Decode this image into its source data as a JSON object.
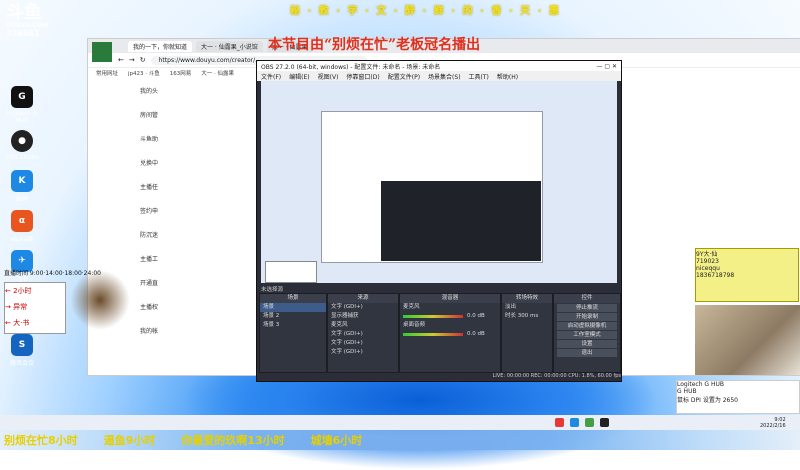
{
  "top_scroll": "秘 · 教 · 字 · 文 · 醉  · 鲜 · 的 · 香 · 天 · 惠",
  "banner": "本节目由“别烦在忙”老板冠名播出",
  "logo": {
    "brand": "斗鱼",
    "site": "DOUYU.COM",
    "room": "336661"
  },
  "desktop_icons": [
    {
      "label": "logitech G HUB",
      "color": "#111"
    },
    {
      "label": "OBS Studio",
      "color": "#222"
    },
    {
      "label": "酷狗",
      "color": "#1e88e5"
    },
    {
      "label": "alpha赛",
      "color": "#e8551e"
    },
    {
      "label": "飞书",
      "color": "#1e88e5"
    },
    {
      "label": "腾讯会议",
      "color": "#1565c0"
    }
  ],
  "browser": {
    "tabs": [
      "我的一下，你就知道",
      "大一 · 仙露果_小说馆",
      "大一 · 仙露果"
    ],
    "url": "https://www.douyu.com/creator/...",
    "bookmarks": [
      "常用网址",
      "jp423 · 斗鱼",
      "163网易",
      "大一 · 仙露果"
    ],
    "side": [
      "我的头",
      "房间管",
      "斗鱼助",
      "兑换中",
      "主播任",
      "签约申",
      "防沉迷",
      "主播工",
      "开通直",
      "主播权",
      "我的帐"
    ]
  },
  "obs": {
    "title": "OBS 27.2.0 (64-bit, windows) - 配置文件: 未命名 - 场景: 未命名",
    "menu": [
      "文件(F)",
      "编辑(E)",
      "视图(V)",
      "停靠窗口(D)",
      "配置文件(P)",
      "场景集合(S)",
      "工具(T)",
      "帮助(H)"
    ],
    "preview_label": "未选择源",
    "docks": {
      "scenes": {
        "title": "场景",
        "items": [
          "场景",
          "场景 2",
          "场景 3"
        ]
      },
      "sources": {
        "title": "来源",
        "items": [
          "文字 (GDI+)",
          "显示器捕获",
          "麦克风",
          "文字 (GDI+)",
          "文字 (GDI+)",
          "文字 (GDI+)"
        ]
      },
      "mixer": {
        "title": "混音器",
        "channels": [
          "麦克风",
          "桌面音频"
        ],
        "db": [
          "0.0 dB",
          "0.0 dB"
        ]
      },
      "transitions": {
        "title": "转场特效",
        "type": "淡出",
        "duration_label": "时长",
        "duration": "300 ms"
      },
      "controls": {
        "title": "控件",
        "buttons": [
          "停止推流",
          "开始录制",
          "启动虚拟摄像机",
          "工作室模式",
          "设置",
          "退出"
        ]
      }
    },
    "status": "LIVE: 00:00:00   REC: 00:00:00   CPU: 1.8%, 60.00 fps"
  },
  "schedule": "直播时间 9:00·14:00·18:00·24:00",
  "overlay_left": [
    "← 2小时",
    "→ 异常",
    "← 大·书"
  ],
  "overlay_right": {
    "lines": [
      "9Y大·仙",
      "719023",
      "niceqqu",
      "1836718798"
    ]
  },
  "notification": {
    "app": "Logitech G HUB",
    "title": "G HUB",
    "body": "鼠标 DPI 设置为 2650"
  },
  "ticker": [
    "别烦在忙8小时",
    "逼鱼9小时",
    "你最爱的玖啊13小时",
    "城墙6小时"
  ],
  "clock": {
    "time": "9:02",
    "date": "2022/2/16"
  }
}
